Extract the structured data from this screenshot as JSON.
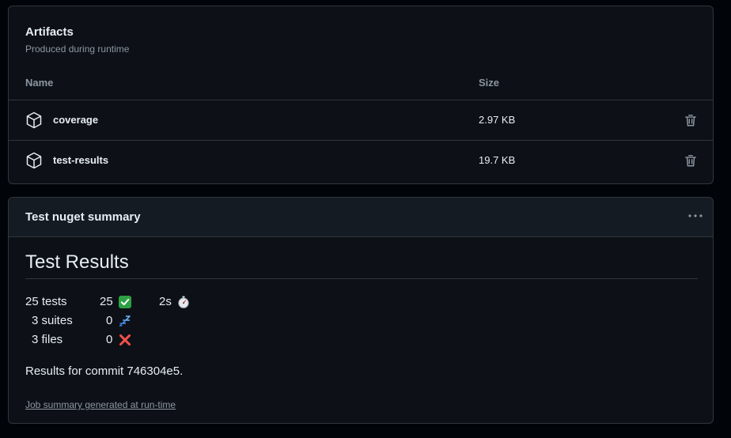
{
  "artifacts": {
    "title": "Artifacts",
    "subtitle": "Produced during runtime",
    "columns": {
      "name": "Name",
      "size": "Size"
    },
    "items": [
      {
        "name": "coverage",
        "size": "2.97 KB",
        "icon": "package-icon"
      },
      {
        "name": "test-results",
        "size": "19.7 KB",
        "icon": "package-icon"
      }
    ]
  },
  "summary": {
    "title": "Test nuget summary",
    "heading": "Test Results",
    "stats": {
      "tests": "25 tests",
      "passed": "25",
      "duration": "2s",
      "suites": "3 suites",
      "skipped": "0",
      "files": "3 files",
      "failed": "0"
    },
    "commit_text": "Results for commit 746304e5.",
    "footer_link": "Job summary generated at run-time"
  },
  "colors": {
    "background": "#010409",
    "panel": "#0d1117",
    "border": "#30363d",
    "text": "#e6edf3",
    "muted": "#8d96a0",
    "pass": "#2ea043",
    "fail": "#f85149"
  }
}
